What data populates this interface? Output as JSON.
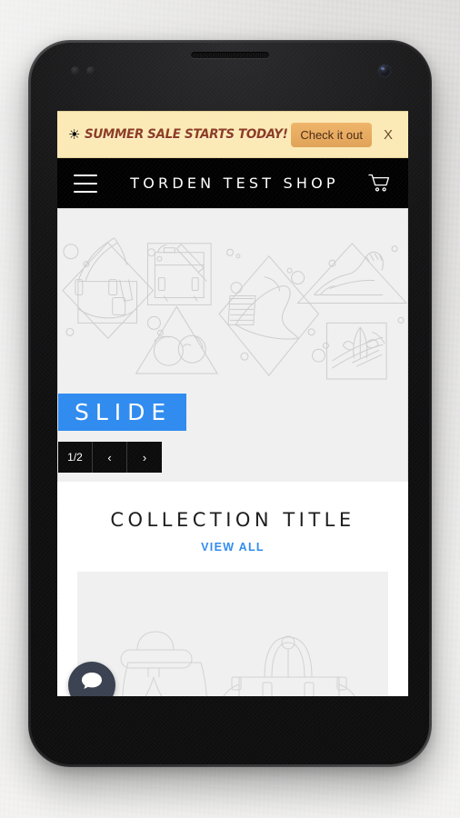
{
  "device": {
    "name": "smartphone-mockup",
    "earpiece": "earpiece-speaker",
    "camera": "front-camera"
  },
  "promo_banner": {
    "sun_left": "☀",
    "sun_right": "☀",
    "text": "SUMMER SALE STARTS TODAY!",
    "cta_label": "Check it out",
    "close_label": "X",
    "background_color": "#fbeab6",
    "text_color": "#8c3b23",
    "cta_color": "#e8aa60"
  },
  "header": {
    "title": "TORDEN TEST SHOP",
    "menu_icon": "hamburger-menu-icon",
    "cart_icon": "shopping-cart-icon",
    "background_color": "#000000"
  },
  "hero": {
    "slide_label": "SLIDE",
    "slide_label_color": "#2f8bef",
    "counter": "1/2",
    "prev_label": "‹",
    "next_label": "›",
    "background_color": "#f0f0f0",
    "illustration": "fashion-line-art-handbag-satchel-heel-sneaker-sunglasses"
  },
  "collection": {
    "title": "COLLECTION TITLE",
    "view_all_label": "VIEW ALL",
    "view_all_color": "#2f8bef",
    "image_alt": "line-art-handbags-product-image",
    "image_background": "#f0f0f0"
  },
  "chat": {
    "icon": "chat-bubble-icon",
    "background_color": "#3a4150"
  }
}
